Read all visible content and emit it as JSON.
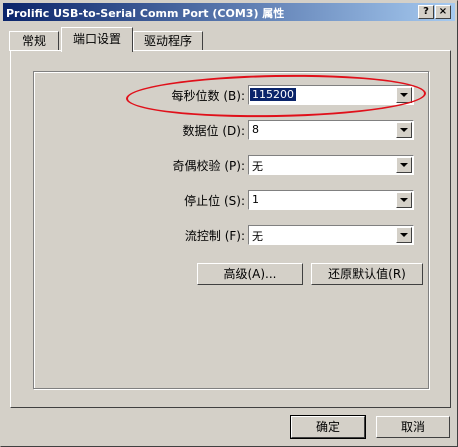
{
  "window": {
    "title": "Prolific USB-to-Serial Comm Port (COM3) 属性",
    "help_button": "?",
    "close_button": "×"
  },
  "tabs": [
    {
      "label": "常规",
      "active": false
    },
    {
      "label": "端口设置",
      "active": true
    },
    {
      "label": "驱动程序",
      "active": false
    }
  ],
  "settings": {
    "baud_rate": {
      "label": "每秒位数 (B):",
      "value": "115200"
    },
    "data_bits": {
      "label": "数据位 (D):",
      "value": "8"
    },
    "parity": {
      "label": "奇偶校验 (P):",
      "value": "无"
    },
    "stop_bits": {
      "label": "停止位 (S):",
      "value": "1"
    },
    "flow_control": {
      "label": "流控制 (F):",
      "value": "无"
    }
  },
  "buttons": {
    "advanced": "高级(A)...",
    "restore_defaults": "还原默认值(R)",
    "ok": "确定",
    "cancel": "取消"
  },
  "annotation": {
    "color": "#e0101a"
  }
}
